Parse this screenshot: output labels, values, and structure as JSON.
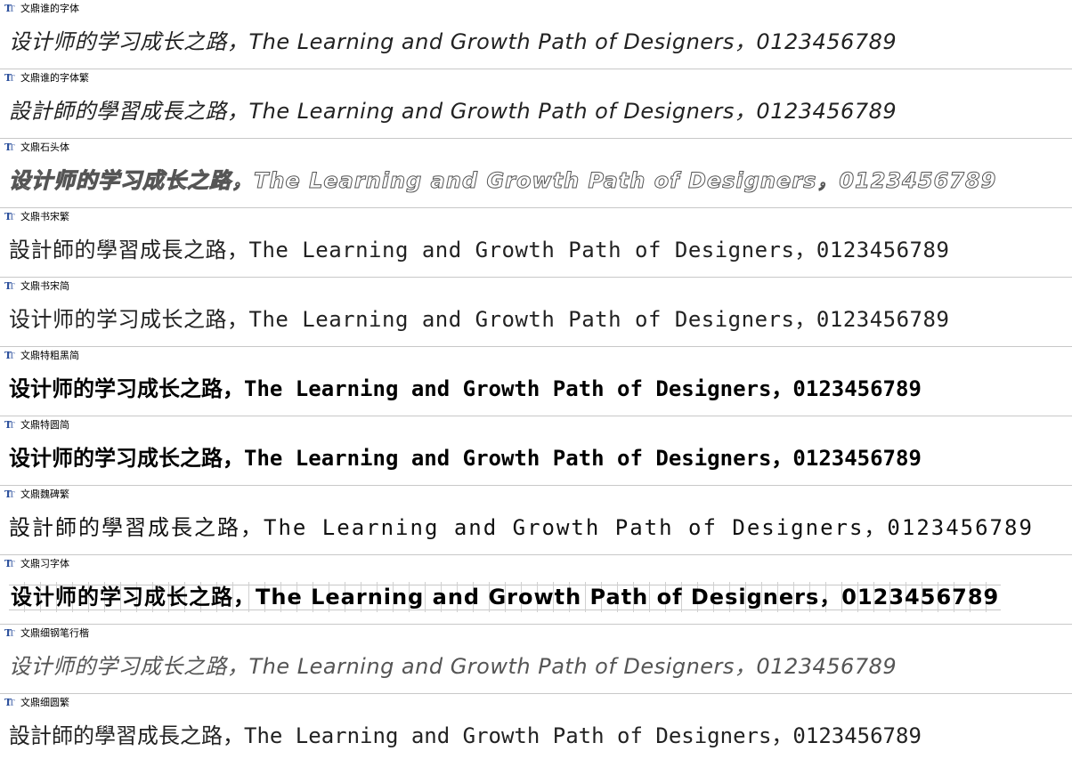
{
  "fonts": [
    {
      "name": "文鼎谁的字体",
      "sample": "设计师的学习成长之路，The Learning and Growth Path of Designers，0123456789",
      "style": "s-hand"
    },
    {
      "name": "文鼎谁的字体繁",
      "sample": "設計師的學習成長之路，The Learning and Growth Path of Designers，0123456789",
      "style": "s-hand"
    },
    {
      "name": "文鼎石头体",
      "sample": "设计师的学习成长之路，The Learning and Growth Path of Designers，0123456789",
      "style": "s-outline"
    },
    {
      "name": "文鼎书宋繁",
      "sample": "設計師的學習成長之路，The Learning and Growth Path of Designers，0123456789",
      "style": "s-song"
    },
    {
      "name": "文鼎书宋简",
      "sample": "设计师的学习成长之路，The Learning and Growth Path of Designers，0123456789",
      "style": "s-song"
    },
    {
      "name": "文鼎特粗黑简",
      "sample": "设计师的学习成长之路，The Learning and Growth Path of Designers，0123456789",
      "style": "s-black"
    },
    {
      "name": "文鼎特圆简",
      "sample": "设计师的学习成长之路，The Learning and Growth Path of Designers，0123456789",
      "style": "s-round"
    },
    {
      "name": "文鼎魏碑繁",
      "sample": "設計師的學習成長之路，The Learning and Growth Path of Designers，0123456789",
      "style": "s-wei"
    },
    {
      "name": "文鼎习字体",
      "sample": "设计师的学习成长之路，The Learning and Growth Path of Designers，0123456789",
      "style": "s-grid"
    },
    {
      "name": "文鼎细钢笔行楷",
      "sample": "设计师的学习成长之路，The Learning and Growth Path of Designers，0123456789",
      "style": "s-pen"
    },
    {
      "name": "文鼎细圆繁",
      "sample": "設計師的學習成長之路，The Learning and Growth Path of Designers，0123456789",
      "style": "s-thin"
    }
  ],
  "icon": "truetype-font-icon",
  "icon_colors": {
    "primary": "#2b4f9c",
    "secondary": "#7f95c4"
  }
}
